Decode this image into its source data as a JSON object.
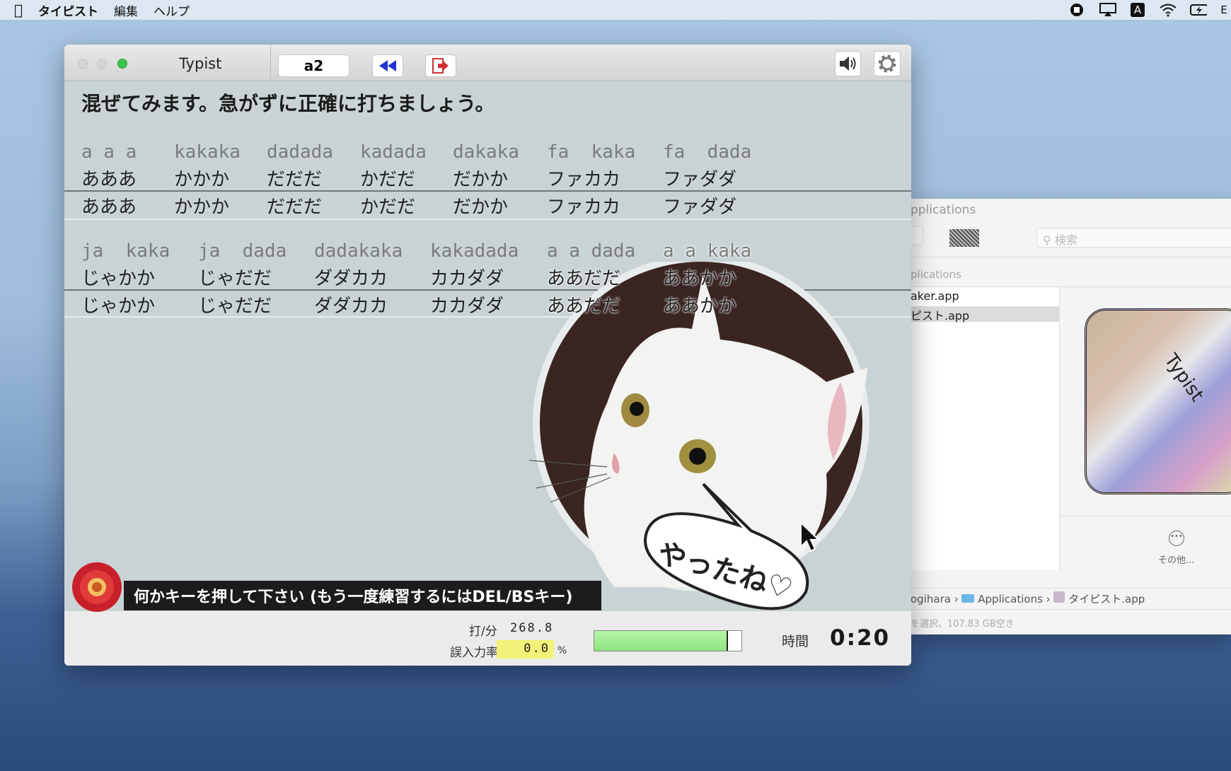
{
  "menubar": {
    "apple": "",
    "app": "タイピスト",
    "items": [
      "編集",
      "ヘルプ"
    ],
    "status_icons": [
      "screen-record-icon",
      "airplay-icon",
      "input-source-icon",
      "wifi-icon",
      "battery-icon"
    ],
    "input_source": "A"
  },
  "typist": {
    "title": "Typist",
    "mode_button": "a2",
    "heading": "混ぜてみます。急がずに正確に打ちましょう。",
    "blocks": [
      {
        "romaji": [
          "a a a",
          "kakaka",
          "dadada",
          "kadada",
          "dakaka",
          "fa  kaka",
          "fa  dada"
        ],
        "kana": [
          "あああ",
          "かかか",
          "だだだ",
          "かだだ",
          "だかか",
          "ファカカ",
          "ファダダ"
        ],
        "typed": [
          "あああ",
          "かかか",
          "だだだ",
          "かだだ",
          "だかか",
          "ファカカ",
          "ファダダ"
        ]
      },
      {
        "romaji": [
          "ja  kaka",
          "ja  dada",
          "dadakaka",
          "kakadada",
          "a a dada",
          "a a kaka"
        ],
        "kana": [
          "じゃかか",
          "じゃだだ",
          "ダダカカ",
          "カカダダ",
          "ああだだ",
          "ああかか"
        ],
        "typed": [
          "じゃかか",
          "じゃだだ",
          "ダダカカ",
          "カカダダ",
          "ああだだ",
          "ああかか"
        ]
      }
    ],
    "sticker_text": "やったね♡",
    "message": "何かキーを押して下さい (もう一度練習するにはDEL/BSキー)",
    "stats": {
      "speed_label": "打/分",
      "speed": "268.8",
      "error_label": "誤入力率",
      "error_rate": "0.0",
      "error_unit": "%",
      "progress": 0.91,
      "time_label": "時間",
      "time": "0:20"
    },
    "colors": {
      "background": "#c9d3d5",
      "progress": "#9ef08f",
      "error_highlight": "#f2f27a",
      "rewind": "#2233cc",
      "exit": "#d03030"
    }
  },
  "finder": {
    "title": "pplications",
    "search_placeholder": "検索",
    "path_header": "plications",
    "files": [
      "aker.app",
      "ピスト.app"
    ],
    "preview_label": "Typist",
    "more_label": "その他...",
    "breadcrumb": [
      "ogihara",
      "Applications",
      "タイピスト.app"
    ],
    "status": "を選択、107.83 GB空き"
  }
}
